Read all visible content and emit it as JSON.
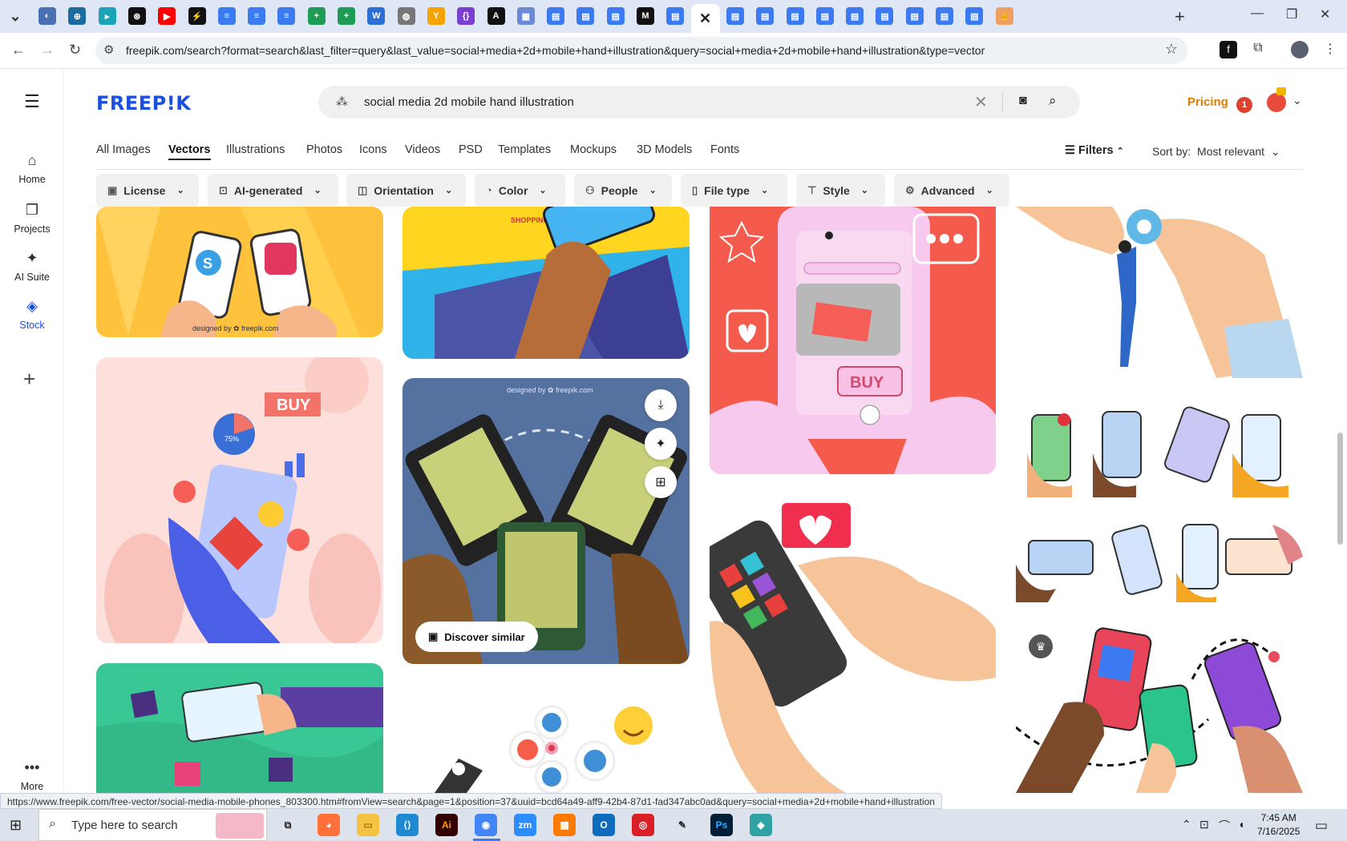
{
  "browser": {
    "tabs": [
      {
        "icon": "chevron-down-icon",
        "color": "#3a3f4b",
        "glyph": "⌄"
      },
      {
        "icon": "globe-icon",
        "color": "#4a6fb3",
        "glyph": "◐"
      },
      {
        "icon": "shield-icon",
        "color": "#1b6aa0",
        "glyph": "⊕"
      },
      {
        "icon": "app-icon",
        "color": "#1ba3b8",
        "glyph": "▸"
      },
      {
        "icon": "openai-icon",
        "color": "#111111",
        "glyph": "⊛"
      },
      {
        "icon": "youtube-icon",
        "color": "#ff0000",
        "glyph": "▶"
      },
      {
        "icon": "bolt-icon",
        "color": "#111111",
        "glyph": "⚡"
      },
      {
        "icon": "docs-icon",
        "color": "#3b7af0",
        "glyph": "≡"
      },
      {
        "icon": "docs-icon",
        "color": "#3b7af0",
        "glyph": "≡"
      },
      {
        "icon": "docs-icon",
        "color": "#3b7af0",
        "glyph": "≡"
      },
      {
        "icon": "sheets-icon",
        "color": "#1e9c55",
        "glyph": "+"
      },
      {
        "icon": "sheets-icon",
        "color": "#1e9c55",
        "glyph": "+"
      },
      {
        "icon": "word-icon",
        "color": "#2b6fd6",
        "glyph": "W"
      },
      {
        "icon": "globe-icon",
        "color": "#777777",
        "glyph": "◍"
      },
      {
        "icon": "fork-icon",
        "color": "#f5a300",
        "glyph": "Y"
      },
      {
        "icon": "code-icon",
        "color": "#7a3fd0",
        "glyph": "{}"
      },
      {
        "icon": "a-icon",
        "color": "#111111",
        "glyph": "A"
      },
      {
        "icon": "grid-icon",
        "color": "#6a8ad6",
        "glyph": "▦"
      },
      {
        "icon": "page-icon",
        "color": "#3b7af0",
        "glyph": "▤"
      },
      {
        "icon": "page-icon",
        "color": "#3b7af0",
        "glyph": "▤"
      },
      {
        "icon": "page-icon",
        "color": "#3b7af0",
        "glyph": "▤"
      },
      {
        "icon": "m-icon",
        "color": "#111111",
        "glyph": "M"
      },
      {
        "icon": "page-icon",
        "color": "#3b7af0",
        "glyph": "▤"
      },
      {
        "icon": "close-icon",
        "color": "#ffffff",
        "glyph": "✕",
        "active": true
      },
      {
        "icon": "page-icon",
        "color": "#3b7af0",
        "glyph": "▤"
      },
      {
        "icon": "page-icon",
        "color": "#3b7af0",
        "glyph": "▤"
      },
      {
        "icon": "page-icon",
        "color": "#3b7af0",
        "glyph": "▤"
      },
      {
        "icon": "page-icon",
        "color": "#3b7af0",
        "glyph": "▤"
      },
      {
        "icon": "page-icon",
        "color": "#3b7af0",
        "glyph": "▤"
      },
      {
        "icon": "page-icon",
        "color": "#3b7af0",
        "glyph": "▤"
      },
      {
        "icon": "page-icon",
        "color": "#3b7af0",
        "glyph": "▤"
      },
      {
        "icon": "page-icon",
        "color": "#3b7af0",
        "glyph": "▤"
      },
      {
        "icon": "page-icon",
        "color": "#3b7af0",
        "glyph": "▤"
      },
      {
        "icon": "hand-icon",
        "color": "#f0a060",
        "glyph": "☝"
      }
    ],
    "new_tab": "+",
    "url": "freepik.com/search?format=search&last_filter=query&last_value=social+media+2d+mobile+hand+illustration&query=social+media+2d+mobile+hand+illustration&type=vector",
    "status_url": "https://www.freepik.com/free-vector/social-media-mobile-phones_803300.htm#fromView=search&page=1&position=37&uuid=bcd64a49-aff9-42b4-87d1-fad347abc0ad&query=social+media+2d+mobile+hand+illustration"
  },
  "sidebar": {
    "items": [
      {
        "label": "Home",
        "icon": "home-icon",
        "glyph": "⌂"
      },
      {
        "label": "Projects",
        "icon": "projects-icon",
        "glyph": "❐"
      },
      {
        "label": "AI Suite",
        "icon": "sparkle-icon",
        "glyph": "✦"
      },
      {
        "label": "Stock",
        "icon": "stock-icon",
        "glyph": "◈",
        "active": true
      }
    ],
    "add": "+",
    "more_label": "More",
    "more_glyph": "•••"
  },
  "header": {
    "logo": "FREEP!K",
    "search_value": "social media 2d mobile hand illustration",
    "pricing": "Pricing",
    "notification_count": "1"
  },
  "type_tabs": [
    "All Images",
    "Vectors",
    "Illustrations",
    "Photos",
    "Icons",
    "Videos",
    "PSD",
    "Templates",
    "Mockups",
    "3D Models",
    "Fonts"
  ],
  "active_type": "Vectors",
  "filters_label": "Filters",
  "sort": {
    "label": "Sort by:",
    "value": "Most relevant"
  },
  "filter_chips": [
    {
      "label": "License",
      "icon": "license-icon",
      "glyph": "▣"
    },
    {
      "label": "AI-generated",
      "icon": "ai-icon",
      "glyph": "⊡"
    },
    {
      "label": "Orientation",
      "icon": "orientation-icon",
      "glyph": "◫"
    },
    {
      "label": "Color",
      "icon": "palette-icon",
      "glyph": "◔"
    },
    {
      "label": "People",
      "icon": "people-icon",
      "glyph": "⚇"
    },
    {
      "label": "File type",
      "icon": "file-icon",
      "glyph": "▯"
    },
    {
      "label": "Style",
      "icon": "brush-icon",
      "glyph": "⊤"
    },
    {
      "label": "Advanced",
      "icon": "gear-icon",
      "glyph": "⚙"
    }
  ],
  "cards": {
    "card1_credit": "designed by ✿ freepik.com",
    "card2_text": "SHOPPING",
    "card3_buy": "BUY",
    "card4_buy": "BUY",
    "card4_pct": "75%",
    "card5_credit": "designed by ✿ freepik.com",
    "discover_label": "Discover similar"
  },
  "taskbar": {
    "search_placeholder": "Type here to search",
    "time": "7:45 AM",
    "date": "7/16/2025",
    "apps": [
      {
        "icon": "task-view-icon",
        "color": "#dde3ec",
        "glyph": "⧉",
        "fg": "#222"
      },
      {
        "icon": "firefox-icon",
        "color": "#ff7139",
        "glyph": "◕",
        "fg": "#fff"
      },
      {
        "icon": "explorer-icon",
        "color": "#f5c343",
        "glyph": "▭",
        "fg": "#a57400"
      },
      {
        "icon": "vscode-icon",
        "color": "#1f8ad2",
        "glyph": "⟨⟩",
        "fg": "#fff"
      },
      {
        "icon": "illustrator-icon",
        "color": "#330000",
        "glyph": "Ai",
        "fg": "#ff9a00"
      },
      {
        "icon": "chrome-icon",
        "color": "#4285f4",
        "glyph": "◉",
        "fg": "#fff"
      },
      {
        "icon": "zoom-icon",
        "color": "#2d8cff",
        "glyph": "zm",
        "fg": "#fff"
      },
      {
        "icon": "app-icon",
        "color": "#ff7a00",
        "glyph": "▦",
        "fg": "#fff"
      },
      {
        "icon": "outlook-icon",
        "color": "#0f6cbd",
        "glyph": "O",
        "fg": "#fff"
      },
      {
        "icon": "cloud-icon",
        "color": "#da1f26",
        "glyph": "◎",
        "fg": "#fff"
      },
      {
        "icon": "pen-icon",
        "color": "#dde3ec",
        "glyph": "✎",
        "fg": "#222"
      },
      {
        "icon": "photoshop-icon",
        "color": "#001e36",
        "glyph": "Ps",
        "fg": "#31a8ff"
      },
      {
        "icon": "gem-icon",
        "color": "#2fa3a3",
        "glyph": "◆",
        "fg": "#fff"
      }
    ]
  }
}
